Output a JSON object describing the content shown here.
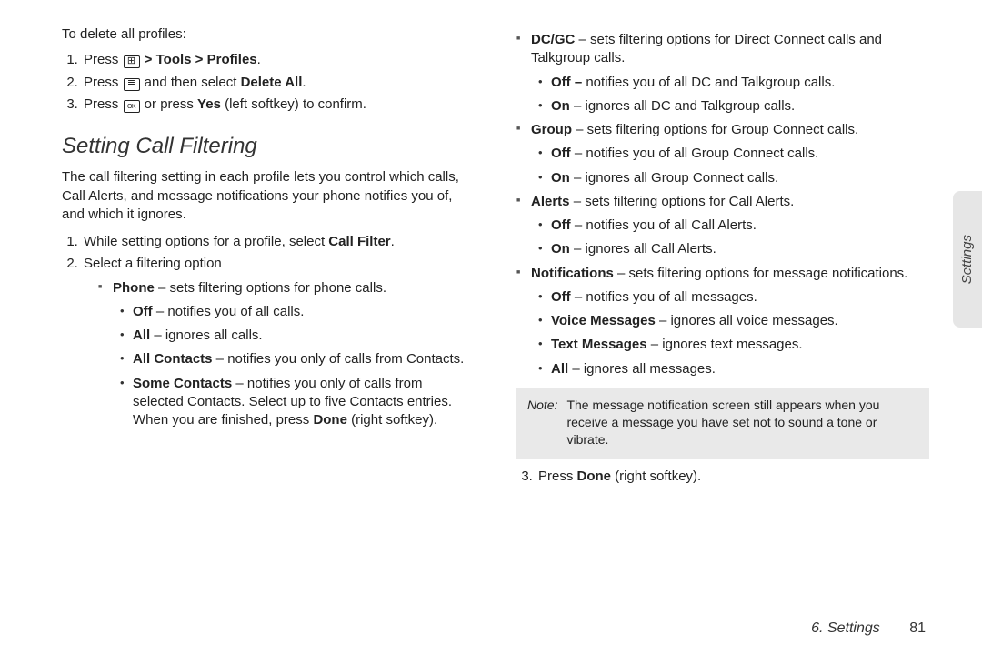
{
  "left": {
    "intro": "To delete all profiles:",
    "deleteSteps": {
      "s1_prefix": "Press ",
      "s1_suffix": " > ",
      "s1_bold1": "Tools",
      "s1_mid": " > ",
      "s1_bold2": "Profiles",
      "s1_end": ".",
      "s2_prefix": "Press ",
      "s2_mid": " and then select ",
      "s2_bold": "Delete All",
      "s2_end": ".",
      "s3_prefix": "Press ",
      "s3_mid": " or press ",
      "s3_bold": "Yes",
      "s3_suffix": " (left softkey) to confirm."
    },
    "heading": "Setting Call Filtering",
    "body": "The call filtering setting in each profile lets you control which calls, Call Alerts, and message notifications your phone notifies you of, and which it ignores.",
    "filterSteps": {
      "s1_prefix": "While setting options for a profile, select ",
      "s1_bold": "Call Filter",
      "s1_end": ".",
      "s2": "Select a filtering option"
    },
    "phone": {
      "label": "Phone",
      "desc": " – sets filtering options for phone calls.",
      "off_l": "Off",
      "off_t": " – notifies you of all calls.",
      "all_l": "All",
      "all_t": " – ignores all calls.",
      "ac_l": "All Contacts",
      "ac_t": " – notifies you only of calls from Contacts.",
      "sc_l": "Some Contacts",
      "sc_t1": " – notifies you only of calls from selected Contacts. Select up to five Contacts entries. When you are finished, press ",
      "sc_bold": "Done",
      "sc_t2": " (right softkey)."
    }
  },
  "right": {
    "dcgc": {
      "label": "DC/GC",
      "desc": " – sets filtering options for Direct Connect calls and Talkgroup calls.",
      "off_l": "Off –",
      "off_t": " notifies you of all DC and Talkgroup calls.",
      "on_l": "On",
      "on_t": " – ignores all DC and Talkgroup calls."
    },
    "group": {
      "label": "Group",
      "desc": " – sets filtering options for Group Connect calls.",
      "off_l": "Off",
      "off_t": " – notifies you of all Group Connect calls.",
      "on_l": "On",
      "on_t": " – ignores all Group Connect calls."
    },
    "alerts": {
      "label": "Alerts",
      "desc": " – sets filtering options for Call Alerts.",
      "off_l": "Off",
      "off_t": " – notifies you of all Call Alerts.",
      "on_l": "On",
      "on_t": " – ignores all Call Alerts."
    },
    "notif": {
      "label": "Notifications",
      "desc": " – sets filtering options for message notifications.",
      "off_l": "Off",
      "off_t": " – notifies you of all messages.",
      "vm_l": "Voice Messages",
      "vm_t": " – ignores all voice messages.",
      "tm_l": "Text Messages",
      "tm_t": " – ignores text messages.",
      "all_l": "All",
      "all_t": " – ignores all messages."
    },
    "note": {
      "label": "Note:",
      "text": "The message notification screen still appears when you receive a message you have set not to sound a tone or vibrate."
    },
    "step3_prefix": "Press ",
    "step3_bold": "Done",
    "step3_suffix": " (right softkey)."
  },
  "sidetab": "Settings",
  "footer": {
    "chapter": "6. Settings",
    "page": "81"
  }
}
